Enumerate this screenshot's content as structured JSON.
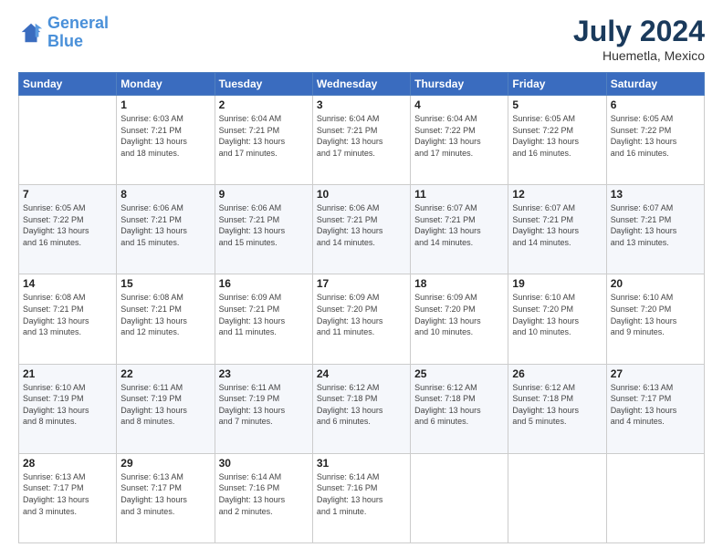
{
  "header": {
    "logo_line1": "General",
    "logo_line2": "Blue",
    "month_year": "July 2024",
    "location": "Huemetla, Mexico"
  },
  "weekdays": [
    "Sunday",
    "Monday",
    "Tuesday",
    "Wednesday",
    "Thursday",
    "Friday",
    "Saturday"
  ],
  "weeks": [
    [
      {
        "day": "",
        "info": ""
      },
      {
        "day": "1",
        "info": "Sunrise: 6:03 AM\nSunset: 7:21 PM\nDaylight: 13 hours\nand 18 minutes."
      },
      {
        "day": "2",
        "info": "Sunrise: 6:04 AM\nSunset: 7:21 PM\nDaylight: 13 hours\nand 17 minutes."
      },
      {
        "day": "3",
        "info": "Sunrise: 6:04 AM\nSunset: 7:21 PM\nDaylight: 13 hours\nand 17 minutes."
      },
      {
        "day": "4",
        "info": "Sunrise: 6:04 AM\nSunset: 7:22 PM\nDaylight: 13 hours\nand 17 minutes."
      },
      {
        "day": "5",
        "info": "Sunrise: 6:05 AM\nSunset: 7:22 PM\nDaylight: 13 hours\nand 16 minutes."
      },
      {
        "day": "6",
        "info": "Sunrise: 6:05 AM\nSunset: 7:22 PM\nDaylight: 13 hours\nand 16 minutes."
      }
    ],
    [
      {
        "day": "7",
        "info": "Sunrise: 6:05 AM\nSunset: 7:22 PM\nDaylight: 13 hours\nand 16 minutes."
      },
      {
        "day": "8",
        "info": "Sunrise: 6:06 AM\nSunset: 7:21 PM\nDaylight: 13 hours\nand 15 minutes."
      },
      {
        "day": "9",
        "info": "Sunrise: 6:06 AM\nSunset: 7:21 PM\nDaylight: 13 hours\nand 15 minutes."
      },
      {
        "day": "10",
        "info": "Sunrise: 6:06 AM\nSunset: 7:21 PM\nDaylight: 13 hours\nand 14 minutes."
      },
      {
        "day": "11",
        "info": "Sunrise: 6:07 AM\nSunset: 7:21 PM\nDaylight: 13 hours\nand 14 minutes."
      },
      {
        "day": "12",
        "info": "Sunrise: 6:07 AM\nSunset: 7:21 PM\nDaylight: 13 hours\nand 14 minutes."
      },
      {
        "day": "13",
        "info": "Sunrise: 6:07 AM\nSunset: 7:21 PM\nDaylight: 13 hours\nand 13 minutes."
      }
    ],
    [
      {
        "day": "14",
        "info": "Sunrise: 6:08 AM\nSunset: 7:21 PM\nDaylight: 13 hours\nand 13 minutes."
      },
      {
        "day": "15",
        "info": "Sunrise: 6:08 AM\nSunset: 7:21 PM\nDaylight: 13 hours\nand 12 minutes."
      },
      {
        "day": "16",
        "info": "Sunrise: 6:09 AM\nSunset: 7:21 PM\nDaylight: 13 hours\nand 11 minutes."
      },
      {
        "day": "17",
        "info": "Sunrise: 6:09 AM\nSunset: 7:20 PM\nDaylight: 13 hours\nand 11 minutes."
      },
      {
        "day": "18",
        "info": "Sunrise: 6:09 AM\nSunset: 7:20 PM\nDaylight: 13 hours\nand 10 minutes."
      },
      {
        "day": "19",
        "info": "Sunrise: 6:10 AM\nSunset: 7:20 PM\nDaylight: 13 hours\nand 10 minutes."
      },
      {
        "day": "20",
        "info": "Sunrise: 6:10 AM\nSunset: 7:20 PM\nDaylight: 13 hours\nand 9 minutes."
      }
    ],
    [
      {
        "day": "21",
        "info": "Sunrise: 6:10 AM\nSunset: 7:19 PM\nDaylight: 13 hours\nand 8 minutes."
      },
      {
        "day": "22",
        "info": "Sunrise: 6:11 AM\nSunset: 7:19 PM\nDaylight: 13 hours\nand 8 minutes."
      },
      {
        "day": "23",
        "info": "Sunrise: 6:11 AM\nSunset: 7:19 PM\nDaylight: 13 hours\nand 7 minutes."
      },
      {
        "day": "24",
        "info": "Sunrise: 6:12 AM\nSunset: 7:18 PM\nDaylight: 13 hours\nand 6 minutes."
      },
      {
        "day": "25",
        "info": "Sunrise: 6:12 AM\nSunset: 7:18 PM\nDaylight: 13 hours\nand 6 minutes."
      },
      {
        "day": "26",
        "info": "Sunrise: 6:12 AM\nSunset: 7:18 PM\nDaylight: 13 hours\nand 5 minutes."
      },
      {
        "day": "27",
        "info": "Sunrise: 6:13 AM\nSunset: 7:17 PM\nDaylight: 13 hours\nand 4 minutes."
      }
    ],
    [
      {
        "day": "28",
        "info": "Sunrise: 6:13 AM\nSunset: 7:17 PM\nDaylight: 13 hours\nand 3 minutes."
      },
      {
        "day": "29",
        "info": "Sunrise: 6:13 AM\nSunset: 7:17 PM\nDaylight: 13 hours\nand 3 minutes."
      },
      {
        "day": "30",
        "info": "Sunrise: 6:14 AM\nSunset: 7:16 PM\nDaylight: 13 hours\nand 2 minutes."
      },
      {
        "day": "31",
        "info": "Sunrise: 6:14 AM\nSunset: 7:16 PM\nDaylight: 13 hours\nand 1 minute."
      },
      {
        "day": "",
        "info": ""
      },
      {
        "day": "",
        "info": ""
      },
      {
        "day": "",
        "info": ""
      }
    ]
  ]
}
